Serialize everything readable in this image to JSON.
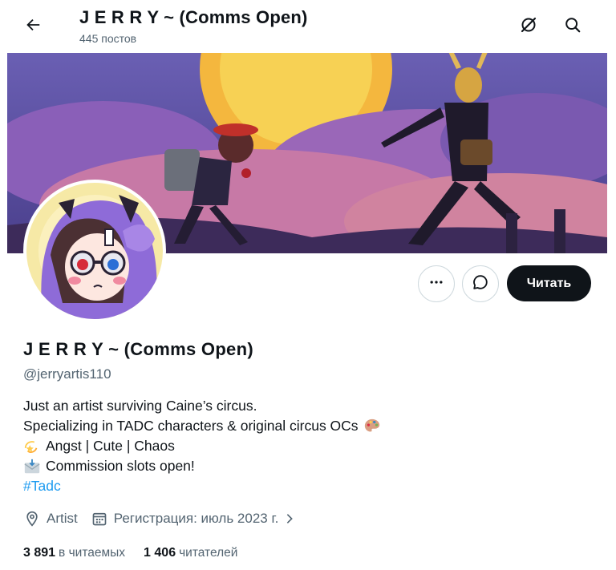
{
  "header": {
    "title": "J E R R Y ~ (Comms Open)",
    "post_count": "445 постов",
    "back_icon": "arrow-left-icon",
    "grok_icon": "grok-icon",
    "search_icon": "search-icon"
  },
  "profile": {
    "display_name": "J E R R Y ~ (Comms Open)",
    "handle": "@jerryartis110",
    "bio_lines": [
      "Just an artist surviving Caine’s circus.",
      "Specializing in TADC characters & original circus OCs",
      "Angst | Cute | Chaos",
      "Commission slots open!"
    ],
    "bio_emojis": [
      "palette-icon",
      "dizzy-star-icon",
      "envelope-icon"
    ],
    "hashtag": "#Tadc",
    "location": "Artist",
    "join_date": "Регистрация: июль 2023 г.",
    "following_count": "3 891",
    "following_label": "в читаемых",
    "followers_count": "1 406",
    "followers_label": "читателей"
  },
  "actions": {
    "more_icon": "more-dots-icon",
    "message_icon": "message-bubble-icon",
    "follow_label": "Читать"
  },
  "colors": {
    "accent": "#1d9bf0",
    "text": "#0f1419",
    "secondary": "#536471",
    "follow_bg": "#0f1419",
    "banner_sky": "#5b53a6",
    "banner_sun": "#f7c948"
  }
}
